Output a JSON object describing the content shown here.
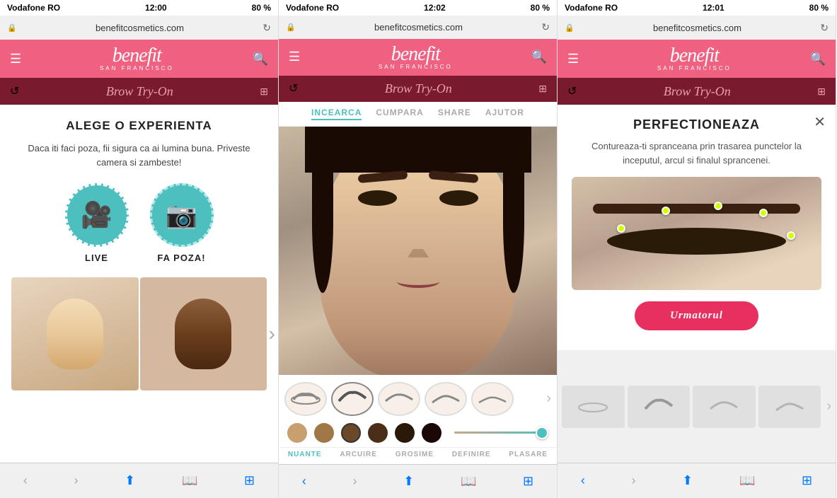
{
  "panels": [
    {
      "id": "panel1",
      "statusBar": {
        "carrier": "Vodafone RO",
        "wifi": "▲",
        "time": "12:00",
        "batteryPercent": "80 %",
        "batteryIcon": "▓"
      },
      "browserUrl": "benefitcosmetics.com",
      "appHeader": {
        "logoText": "benefit",
        "logoSub": "SAN FRANCISCO"
      },
      "browBar": {
        "title": "Brow Try-On",
        "refreshIcon": "↺",
        "gridIcon": "⊞"
      },
      "mainTitle": "ALEGE O EXPERIENTA",
      "mainSubtitle": "Daca iti faci poza, fii sigura ca ai lumina buna. Priveste camera si zambeste!",
      "option1Label": "LIVE",
      "option2Label": "FA POZA!",
      "browserNavItems": [
        "‹",
        "›",
        "↑",
        "□",
        "⊞"
      ]
    },
    {
      "id": "panel2",
      "statusBar": {
        "carrier": "Vodafone RO",
        "wifi": "▲",
        "time": "12:02",
        "batteryPercent": "80 %"
      },
      "browserUrl": "benefitcosmetics.com",
      "appHeader": {
        "logoText": "benefit",
        "logoSub": "SAN FRANCISCO"
      },
      "browBar": {
        "title": "Brow Try-On",
        "refreshIcon": "↺",
        "gridIcon": "⊞"
      },
      "navTabs": [
        "INCEARCA",
        "CUMPARA",
        "SHARE",
        "AJUTOR"
      ],
      "activeTab": "INCEARCA",
      "bottomTabs": [
        "NUANTE",
        "ARCUIRE",
        "GROSIME",
        "DEFINIRE",
        "PLASARE"
      ],
      "activeBottomTab": "NUANTE",
      "colors": [
        {
          "hex": "#c8a070",
          "active": false
        },
        {
          "hex": "#a07848",
          "active": false
        },
        {
          "hex": "#6a4828",
          "active": true
        },
        {
          "hex": "#4a2e18",
          "active": false
        },
        {
          "hex": "#2a1808",
          "active": false
        },
        {
          "hex": "#1a0808",
          "active": false
        }
      ]
    },
    {
      "id": "panel3",
      "statusBar": {
        "carrier": "Vodafone RO",
        "wifi": "▲",
        "time": "12:01",
        "batteryPercent": "80 %"
      },
      "browserUrl": "benefitcosmetics.com",
      "appHeader": {
        "logoText": "benefit",
        "logoSub": "SAN FRANCISCO"
      },
      "browBar": {
        "title": "Brow Try-On",
        "refreshIcon": "↺",
        "gridIcon": "⊞"
      },
      "modalTitle": "PERFECTIONEAZA",
      "modalDesc": "Contureaza-ti spranceana prin trasarea punctelor la inceputul, arcul si finalul sprancenei.",
      "nextBtnLabel": "Urmatorul",
      "dots": [
        {
          "x": "18%",
          "y": "42%"
        },
        {
          "x": "38%",
          "y": "28%"
        },
        {
          "x": "60%",
          "y": "24%"
        },
        {
          "x": "80%",
          "y": "32%"
        },
        {
          "x": "88%",
          "y": "52%"
        }
      ]
    }
  ]
}
